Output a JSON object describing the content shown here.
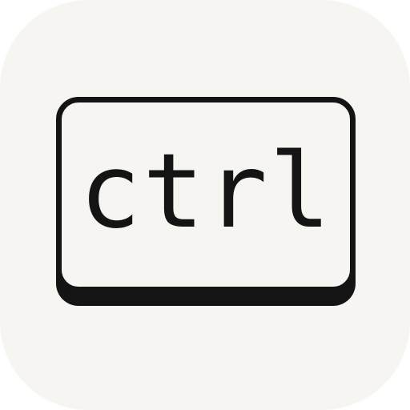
{
  "icon": {
    "name": "keyboard-key-icon",
    "background_color": "#f6f5f2",
    "ink_color": "#141414",
    "key_label": "ctrl"
  }
}
